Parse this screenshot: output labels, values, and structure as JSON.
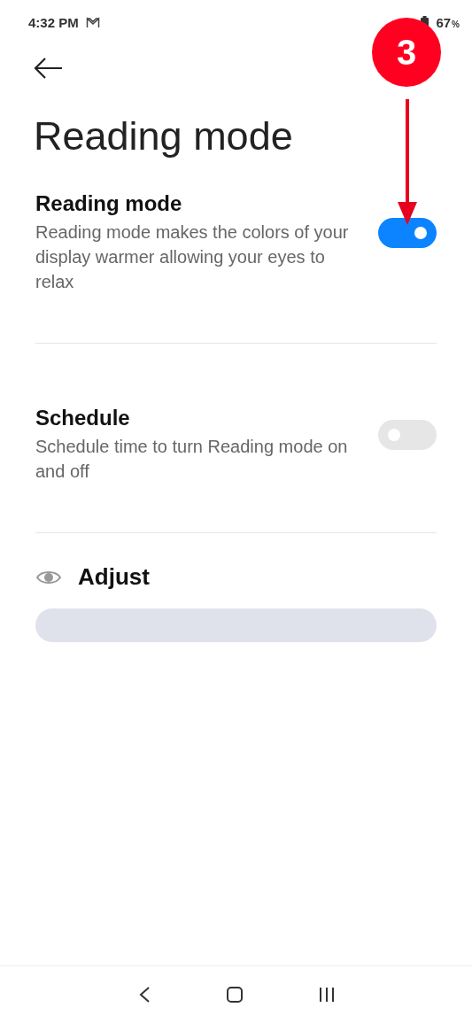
{
  "status_bar": {
    "time": "4:32 PM",
    "battery": "67",
    "battery_unit": "%"
  },
  "title": "Reading mode",
  "settings": [
    {
      "kind": "switch",
      "title": "Reading mode",
      "description": "Reading mode makes the colors of your display warmer allowing your eyes to relax",
      "on": true
    },
    {
      "kind": "switch",
      "title": "Schedule",
      "description": "Schedule time to turn Reading mode on and off",
      "on": false
    }
  ],
  "adjust": {
    "label": "Adjust"
  },
  "annotation": {
    "step": "3"
  }
}
